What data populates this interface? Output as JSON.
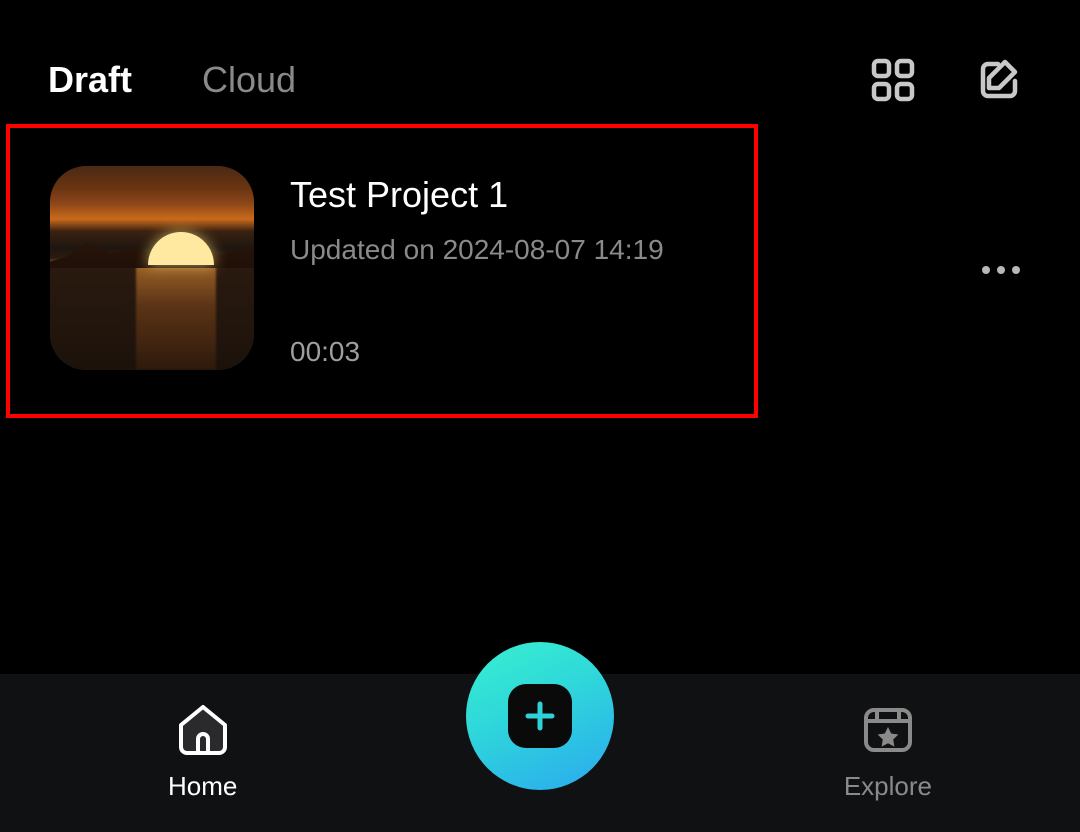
{
  "tabs": {
    "draft": "Draft",
    "cloud": "Cloud",
    "active": "draft"
  },
  "projects": [
    {
      "title": "Test Project 1",
      "updated": "Updated on 2024-08-07 14:19",
      "duration": "00:03"
    }
  ],
  "nav": {
    "home": "Home",
    "explore": "Explore"
  },
  "icons": {
    "grid": "grid-icon",
    "edit": "edit-icon",
    "more": "more-icon",
    "plus": "plus-icon",
    "home": "home-icon",
    "explore": "explore-icon"
  }
}
